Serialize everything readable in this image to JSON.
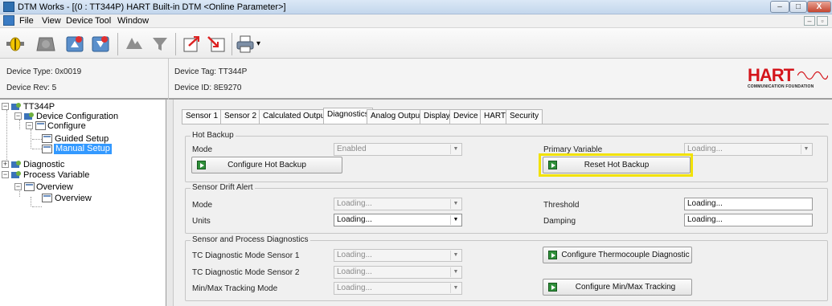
{
  "window": {
    "title": "DTM Works - [(0 : TT344P) HART Built-in DTM <Online Parameter>]",
    "min": "–",
    "max": "□",
    "close": "X"
  },
  "menu": {
    "items": [
      "File",
      "View",
      "Device",
      "Tool",
      "Window"
    ],
    "mdi": [
      "–",
      "▫",
      "x"
    ]
  },
  "toolbar": {
    "icons": [
      "connect-icon",
      "disconnect-icon",
      "upload-icon",
      "download-icon",
      "device-config-icon",
      "device-off-icon",
      "export-icon",
      "import-icon",
      "print-icon"
    ],
    "dropdown": "▾"
  },
  "info": {
    "device_type": "Device Type:  0x0019",
    "device_rev": "Device Rev:  5",
    "device_tag": "Device Tag:  TT344P",
    "device_id": "Device ID:  8E9270",
    "logo": "HART",
    "logo_sub": "COMMUNICATION FOUNDATION"
  },
  "tree": {
    "root": "TT344P",
    "device_configuration": "Device Configuration",
    "configure": "Configure",
    "guided_setup": "Guided Setup",
    "manual_setup": "Manual Setup",
    "diagnostic": "Diagnostic",
    "process_variable": "Process Variable",
    "overview_folder": "Overview",
    "overview_item": "Overview"
  },
  "tabs": [
    "Sensor 1",
    "Sensor 2",
    "Calculated Output",
    "Diagnostics",
    "Analog Output",
    "Display",
    "Device",
    "HART",
    "Security"
  ],
  "active_tab": "Diagnostics",
  "hot_backup": {
    "title": "Hot Backup",
    "mode_label": "Mode",
    "mode_value": "Enabled",
    "primary_variable_label": "Primary Variable",
    "primary_variable_value": "Loading...",
    "configure_button": "Configure Hot Backup",
    "reset_button": "Reset Hot Backup"
  },
  "sensor_drift": {
    "title": "Sensor Drift Alert",
    "mode_label": "Mode",
    "mode_value": "Loading...",
    "units_label": "Units",
    "units_value": "Loading...",
    "threshold_label": "Threshold",
    "threshold_value": "Loading...",
    "damping_label": "Damping",
    "damping_value": "Loading..."
  },
  "sensor_process": {
    "title": "Sensor and Process Diagnostics",
    "tc1_label": "TC Diagnostic Mode Sensor 1",
    "tc1_value": "Loading...",
    "tc2_label": "TC Diagnostic Mode Sensor 2",
    "tc2_value": "Loading...",
    "minmax_label": "Min/Max Tracking Mode",
    "minmax_value": "Loading...",
    "thermocouple_button": "Configure Thermocouple Diagnostic",
    "minmax_button": "Configure Min/Max Tracking"
  },
  "highlight_color": "#f2e200",
  "accent": "#3399ff"
}
